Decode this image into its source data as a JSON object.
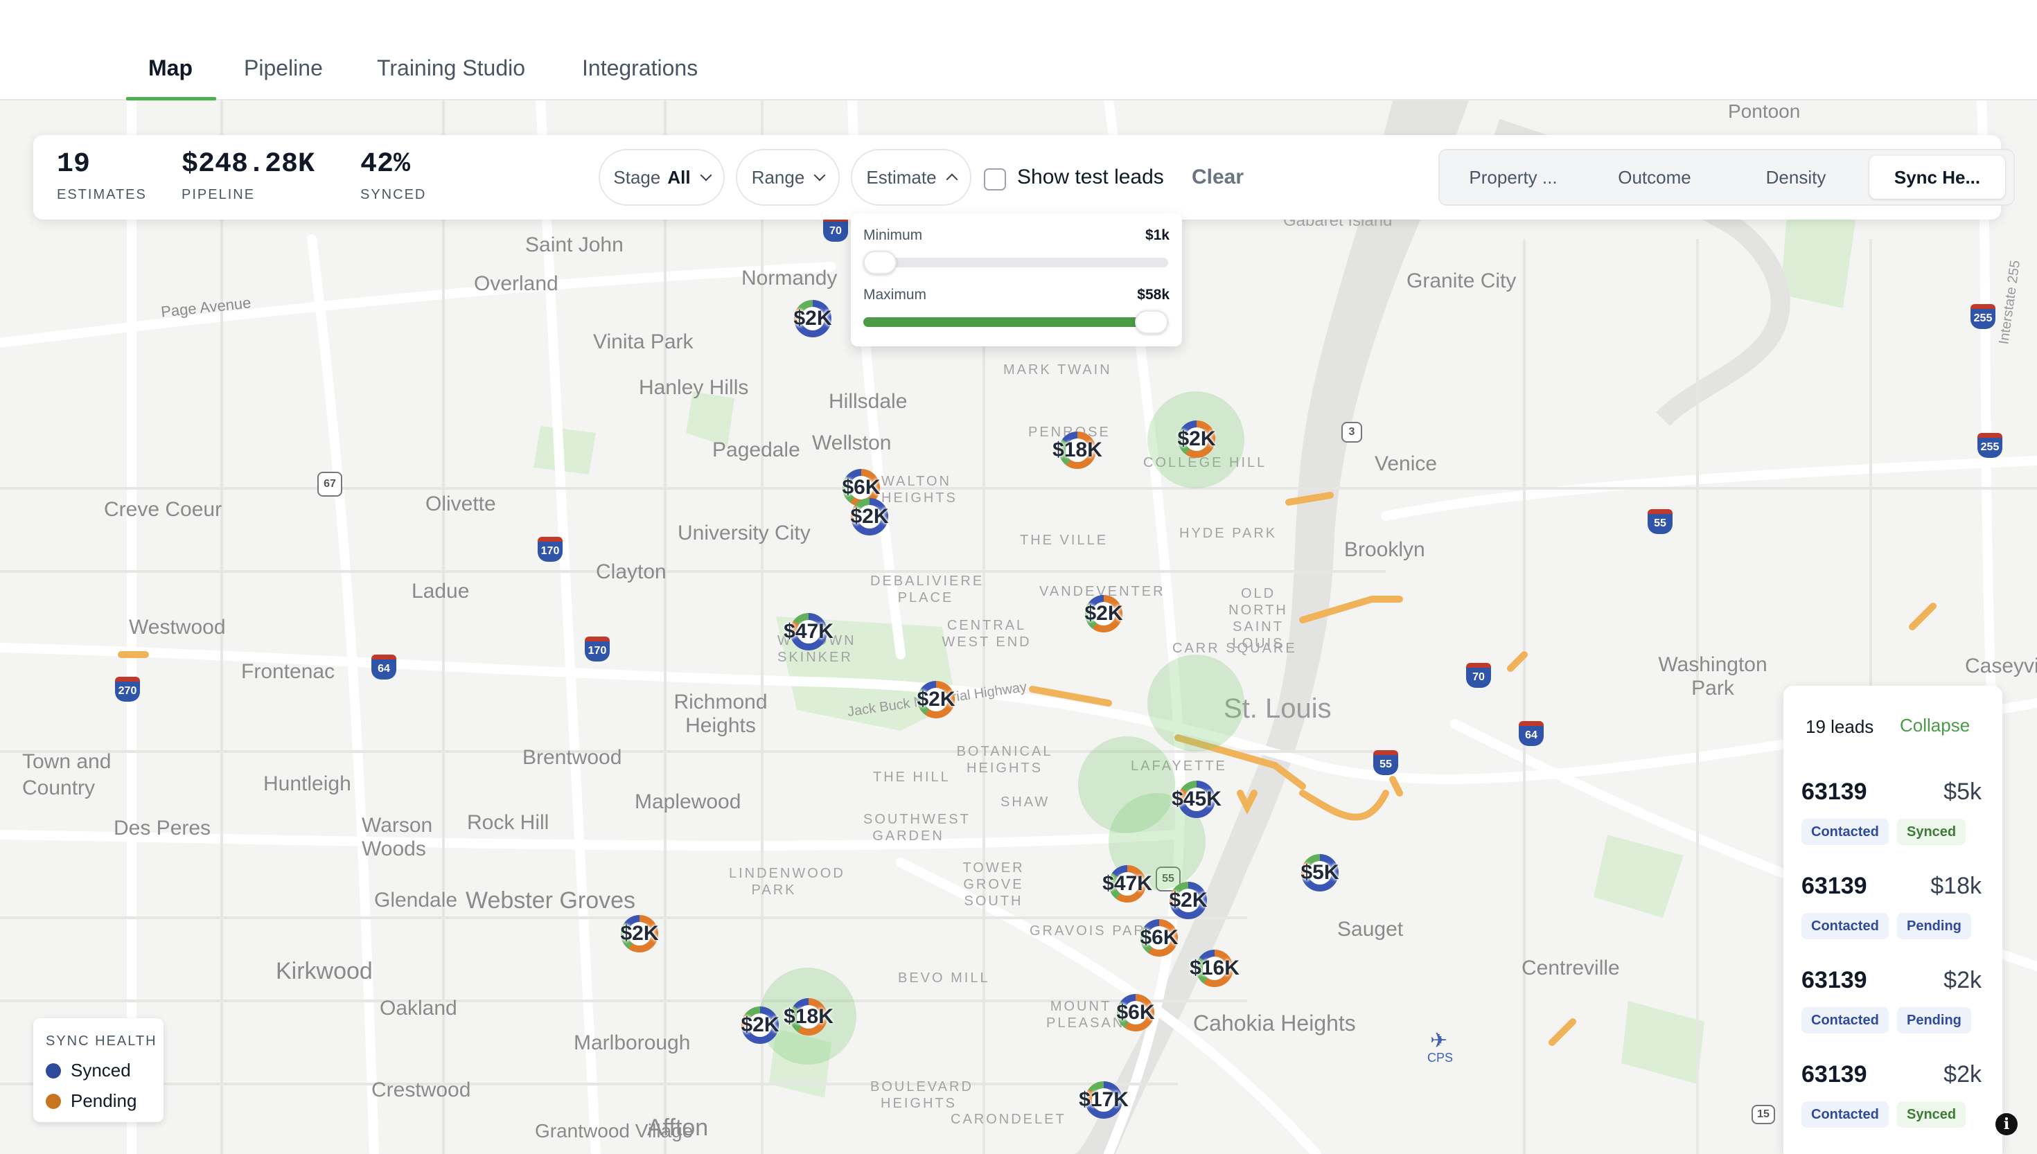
{
  "nav": {
    "tabs": [
      {
        "label": "Map"
      },
      {
        "label": "Pipeline"
      },
      {
        "label": "Training Studio"
      },
      {
        "label": "Integrations"
      }
    ],
    "active_tab": "Map"
  },
  "stats": {
    "estimates": {
      "value": "19",
      "label": "ESTIMATES"
    },
    "pipeline": {
      "value": "$248.28K",
      "label": "PIPELINE"
    },
    "synced": {
      "value": "42%",
      "label": "SYNCED"
    }
  },
  "filters": {
    "stage": {
      "label": "Stage",
      "value": "All"
    },
    "range": {
      "label": "Range"
    },
    "estimate": {
      "label": "Estimate"
    },
    "show_test_leads": {
      "label": "Show test leads",
      "checked": false
    },
    "clear_label": "Clear"
  },
  "layers": {
    "options": [
      "Property ...",
      "Outcome",
      "Density",
      "Sync He..."
    ],
    "active": "Sync He..."
  },
  "estimate_range": {
    "min_label": "Minimum",
    "min_value": "$1k",
    "max_label": "Maximum",
    "max_value": "$58k",
    "min_fraction": 0.0,
    "max_fraction": 1.0
  },
  "map": {
    "places": [
      "Saint John",
      "Overland",
      "Normandy",
      "Vinita Park",
      "Hanley Hills",
      "Hillsdale",
      "Pagedale",
      "Wellston",
      "Creve Coeur",
      "Olivette",
      "University City",
      "Clayton",
      "Ladue",
      "Westwood",
      "Frontenac",
      "Richmond Heights",
      "Brentwood",
      "Town and Country",
      "Huntleigh",
      "Maplewood",
      "Des Peres",
      "Warson Woods",
      "Rock Hill",
      "Glendale",
      "Webster Groves",
      "Kirkwood",
      "Oakland",
      "Marlborough",
      "Crestwood",
      "Grantwood Village",
      "Affton",
      "Granite City",
      "Venice",
      "Brooklyn",
      "Washington Park",
      "Caseyville",
      "St. Louis",
      "Sauget",
      "Centreville",
      "Cahokia Heights",
      "Pontoon",
      "Gabaret Island",
      "Page Avenue",
      "Jack Buck Memorial Highway",
      "Interstate 255",
      "CPS"
    ],
    "districts": [
      "MARK TWAIN",
      "PENROSE",
      "COLLEGE HILL",
      "WALTON HEIGHTS",
      "THE VILLE",
      "HYDE PARK",
      "DEBALIVIERE PLACE",
      "VANDEVENTER",
      "OLD NORTH SAINT LOUIS",
      "CENTRAL WEST END",
      "WYDOWN SKINKER",
      "CARR SQUARE",
      "BOTANICAL HEIGHTS",
      "LAFAYETTE",
      "THE HILL",
      "SOUTHWEST GARDEN",
      "SHAW",
      "LINDENWOOD PARK",
      "TOWER GROVE SOUTH",
      "GRAVOIS PARK",
      "BEVO MILL",
      "MOUNT PLEASANT",
      "BOULEVARD HEIGHTS",
      "CARONDELET"
    ],
    "markers": [
      {
        "amount": "$2K",
        "status": "synced"
      },
      {
        "amount": "$18K",
        "status": "pending"
      },
      {
        "amount": "$2K",
        "status": "pending"
      },
      {
        "amount": "$6K",
        "status": "pending"
      },
      {
        "amount": "$2K",
        "status": "synced"
      },
      {
        "amount": "$47K",
        "status": "synced"
      },
      {
        "amount": "$2K",
        "status": "pending"
      },
      {
        "amount": "$2K",
        "status": "pending"
      },
      {
        "amount": "$45K",
        "status": "synced"
      },
      {
        "amount": "$5K",
        "status": "synced"
      },
      {
        "amount": "$47K",
        "status": "pending"
      },
      {
        "amount": "$2K",
        "status": "synced"
      },
      {
        "amount": "$6K",
        "status": "pending"
      },
      {
        "amount": "$16K",
        "status": "pending"
      },
      {
        "amount": "$2K",
        "status": "pending"
      },
      {
        "amount": "$2K",
        "status": "synced"
      },
      {
        "amount": "$18K",
        "status": "pending"
      },
      {
        "amount": "$6K",
        "status": "pending"
      },
      {
        "amount": "$17K",
        "status": "synced"
      }
    ],
    "shields": [
      "70",
      "3",
      "67",
      "170",
      "170",
      "64",
      "270",
      "255",
      "255",
      "55",
      "70",
      "64",
      "55",
      "55",
      "15"
    ]
  },
  "leads_panel": {
    "count_label": "19 leads",
    "collapse_label": "Collapse",
    "items": [
      {
        "zip": "63139",
        "amount": "$5k",
        "stage": "Contacted",
        "sync": "Synced"
      },
      {
        "zip": "63139",
        "amount": "$18k",
        "stage": "Contacted",
        "sync": "Pending"
      },
      {
        "zip": "63139",
        "amount": "$2k",
        "stage": "Contacted",
        "sync": "Pending"
      },
      {
        "zip": "63139",
        "amount": "$2k",
        "stage": "Contacted",
        "sync": "Synced"
      }
    ]
  },
  "legend": {
    "title": "SYNC HEALTH",
    "items": [
      {
        "label": "Synced",
        "color": "#2f4a9a"
      },
      {
        "label": "Pending",
        "color": "#c8751f"
      }
    ]
  },
  "colors": {
    "accent": "#4caf50",
    "synced": "#2f4a9a",
    "pending": "#c8751f",
    "halo": "#78c86e"
  },
  "info_button": {
    "icon": "info-icon",
    "glyph": "i"
  }
}
